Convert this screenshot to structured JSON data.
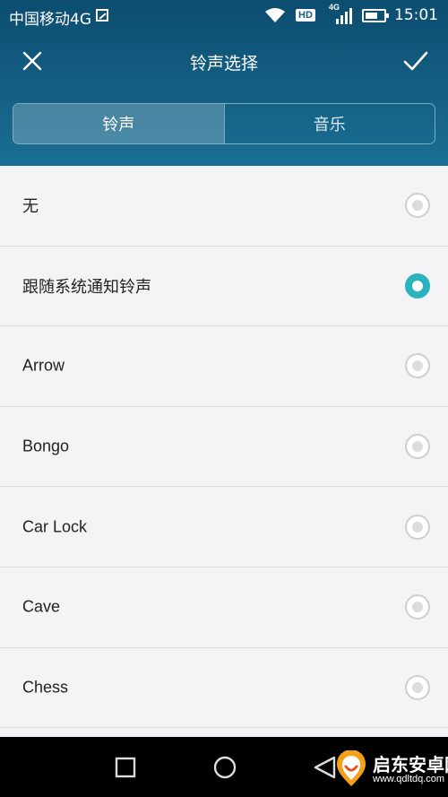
{
  "status_bar": {
    "carrier": "中国移动4G",
    "hd_label": "HD",
    "network_label": "4G",
    "time": "15:01",
    "icons": [
      "photo-icon",
      "wifi-icon",
      "signal-icon",
      "battery-icon"
    ]
  },
  "toolbar": {
    "title": "铃声选择",
    "close_icon": "close-icon",
    "confirm_icon": "check-icon"
  },
  "tabs": [
    {
      "label": "铃声",
      "active": true
    },
    {
      "label": "音乐",
      "active": false
    }
  ],
  "ringtones": [
    {
      "label": "无",
      "selected": false
    },
    {
      "label": "跟随系统通知铃声",
      "selected": true
    },
    {
      "label": "Arrow",
      "selected": false
    },
    {
      "label": "Bongo",
      "selected": false
    },
    {
      "label": "Car Lock",
      "selected": false
    },
    {
      "label": "Cave",
      "selected": false
    },
    {
      "label": "Chess",
      "selected": false
    }
  ],
  "nav_bar": {
    "icons": [
      "recents-icon",
      "home-icon",
      "back-icon"
    ]
  },
  "watermark": {
    "title": "启东安卓网",
    "url": "www.qdltdq.com"
  },
  "colors": {
    "header": "#145f83",
    "accent": "#2ab3bd",
    "list_background": "#f4f3f5"
  }
}
